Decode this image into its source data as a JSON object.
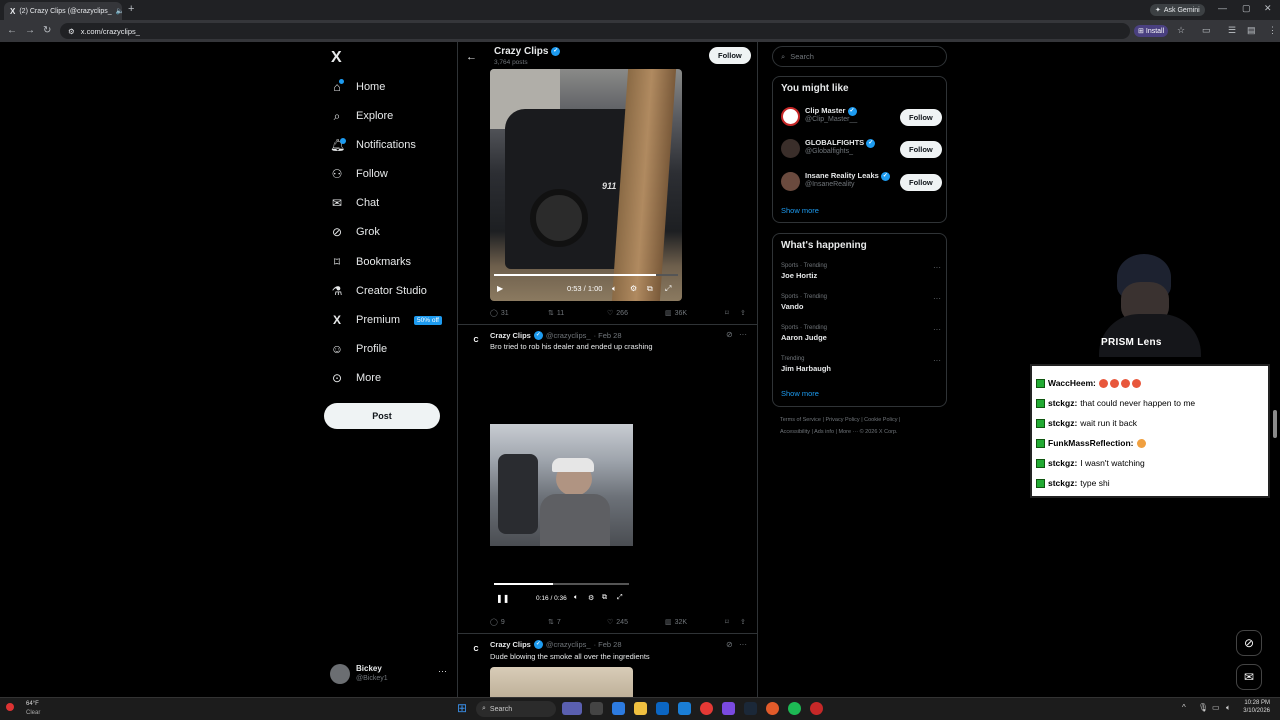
{
  "browser": {
    "tab_title": "(2) Crazy Clips (@crazyclips_",
    "tab_x_logo": "X",
    "ask_gemini": "Ask Gemini",
    "url": "x.com/crazyclips_",
    "install": "Install"
  },
  "nav": {
    "logo": "X",
    "items": [
      {
        "label": "Home",
        "icon": "home-icon"
      },
      {
        "label": "Explore",
        "icon": "search-icon"
      },
      {
        "label": "Notifications",
        "icon": "bell-icon"
      },
      {
        "label": "Follow",
        "icon": "person-add-icon"
      },
      {
        "label": "Chat",
        "icon": "mail-icon"
      },
      {
        "label": "Grok",
        "icon": "grok-icon"
      },
      {
        "label": "Bookmarks",
        "icon": "bookmark-icon"
      },
      {
        "label": "Creator Studio",
        "icon": "flask-icon"
      },
      {
        "label": "Premium",
        "icon": "x-icon"
      },
      {
        "label": "Profile",
        "icon": "profile-icon"
      },
      {
        "label": "More",
        "icon": "more-circle-icon"
      }
    ],
    "premium_badge": "50% off",
    "post_label": "Post",
    "account": {
      "name": "Bickey",
      "handle": "@Bickey1",
      "menu": "···"
    }
  },
  "profile_header": {
    "name": "Crazy Clips",
    "posts": "3,764 posts",
    "follow_label": "Follow"
  },
  "tweets": [
    {
      "video_time": "0:53 / 1:00",
      "progress": 0.88,
      "stats": {
        "replies": "31",
        "reposts": "11",
        "likes": "266",
        "views": "36K"
      }
    },
    {
      "name": "Crazy Clips",
      "handle": "@crazyclips_",
      "date": "· Feb 28",
      "text": "Bro tried to rob his dealer and ended up crashing",
      "video_time": "0:16 / 0:36",
      "progress": 0.44,
      "stats": {
        "replies": "9",
        "reposts": "7",
        "likes": "245",
        "views": "32K"
      }
    },
    {
      "name": "Crazy Clips",
      "handle": "@crazyclips_",
      "date": "· Feb 28",
      "text": "Dude blowing the smoke all over the ingredients"
    }
  ],
  "sidebar": {
    "search_placeholder": "Search",
    "you_might_like": "You might like",
    "suggestions": [
      {
        "name": "Clip Master",
        "handle": "@Clip_Master__",
        "follow": "Follow"
      },
      {
        "name": "GLOBALFIGHTS",
        "handle": "@Globalfights_",
        "follow": "Follow"
      },
      {
        "name": "Insane Reality Leaks",
        "handle": "@InsaneReality",
        "follow": "Follow"
      }
    ],
    "show_more": "Show more",
    "whats_happening": "What's happening",
    "trends": [
      {
        "category": "Sports · Trending",
        "title": "Joe Hortiz"
      },
      {
        "category": "Sports · Trending",
        "title": "Vando"
      },
      {
        "category": "Sports · Trending",
        "title": "Aaron Judge"
      },
      {
        "category": "Trending",
        "title": "Jim Harbaugh"
      }
    ],
    "show_more_2": "Show more",
    "footer_line1": "Terms of Service  |  Privacy Policy  |  Cookie Policy  |",
    "footer_line2": "Accessibility  |  Ads info  |  More ···  © 2026 X Corp."
  },
  "overlay": {
    "lens_label": "PRISM Lens",
    "chat": [
      {
        "user": "WaccHeem:",
        "text": ""
      },
      {
        "user": "stckgz:",
        "text": "that could never happen to me"
      },
      {
        "user": "stckgz:",
        "text": "wait run it back"
      },
      {
        "user": "FunkMassReflection:",
        "text": ""
      },
      {
        "user": "stckgz:",
        "text": "I wasn't watching"
      },
      {
        "user": "stckgz:",
        "text": "type shi"
      }
    ]
  },
  "taskbar": {
    "weather_temp": "64°F",
    "weather_cond": "Clear",
    "search": "Search",
    "time": "10:28 PM",
    "date": "3/10/2026"
  }
}
